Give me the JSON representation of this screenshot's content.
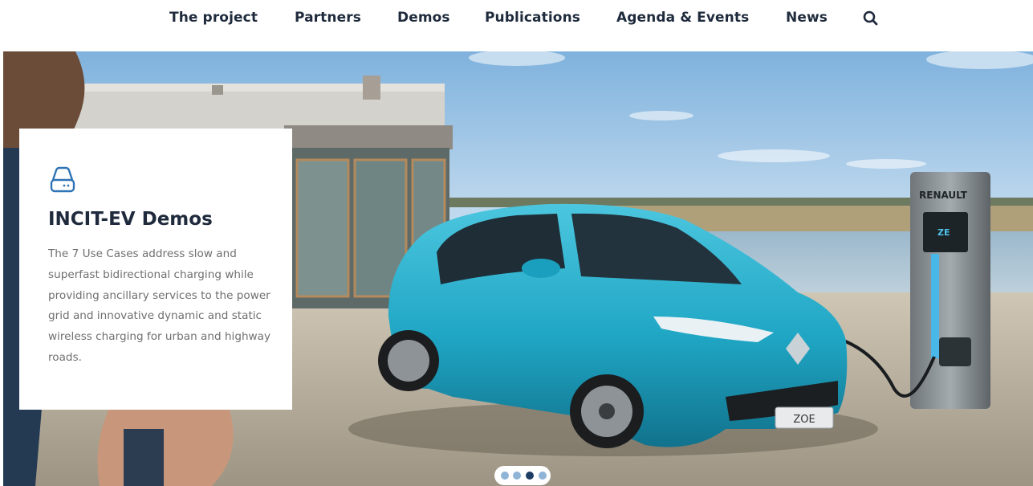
{
  "nav": {
    "items": [
      {
        "label": "The project"
      },
      {
        "label": "Partners"
      },
      {
        "label": "Demos"
      },
      {
        "label": "Publications"
      },
      {
        "label": "Agenda & Events"
      },
      {
        "label": "News"
      }
    ],
    "search_icon": "search-icon"
  },
  "hero": {
    "charger_brand": "RENAULT",
    "charger_screen": "ZE",
    "plate": "ZOE",
    "card": {
      "icon": "hard-drive-icon",
      "title": "INCIT-EV Demos",
      "text": "The 7 Use Cases address slow and superfast bidirectional charging while providing ancillary services to the power grid and innovative dynamic and static wireless charging for urban and highway roads."
    }
  },
  "carousel": {
    "slide_count": 4,
    "active_index": 2
  },
  "colors": {
    "nav_text": "#1f2b3d",
    "card_text": "#6f6f6f",
    "icon_blue": "#2f74b5",
    "car_body": "#1fa6c4",
    "dot_active": "#1f3e63",
    "dot_inactive": "#8fb4d6"
  }
}
